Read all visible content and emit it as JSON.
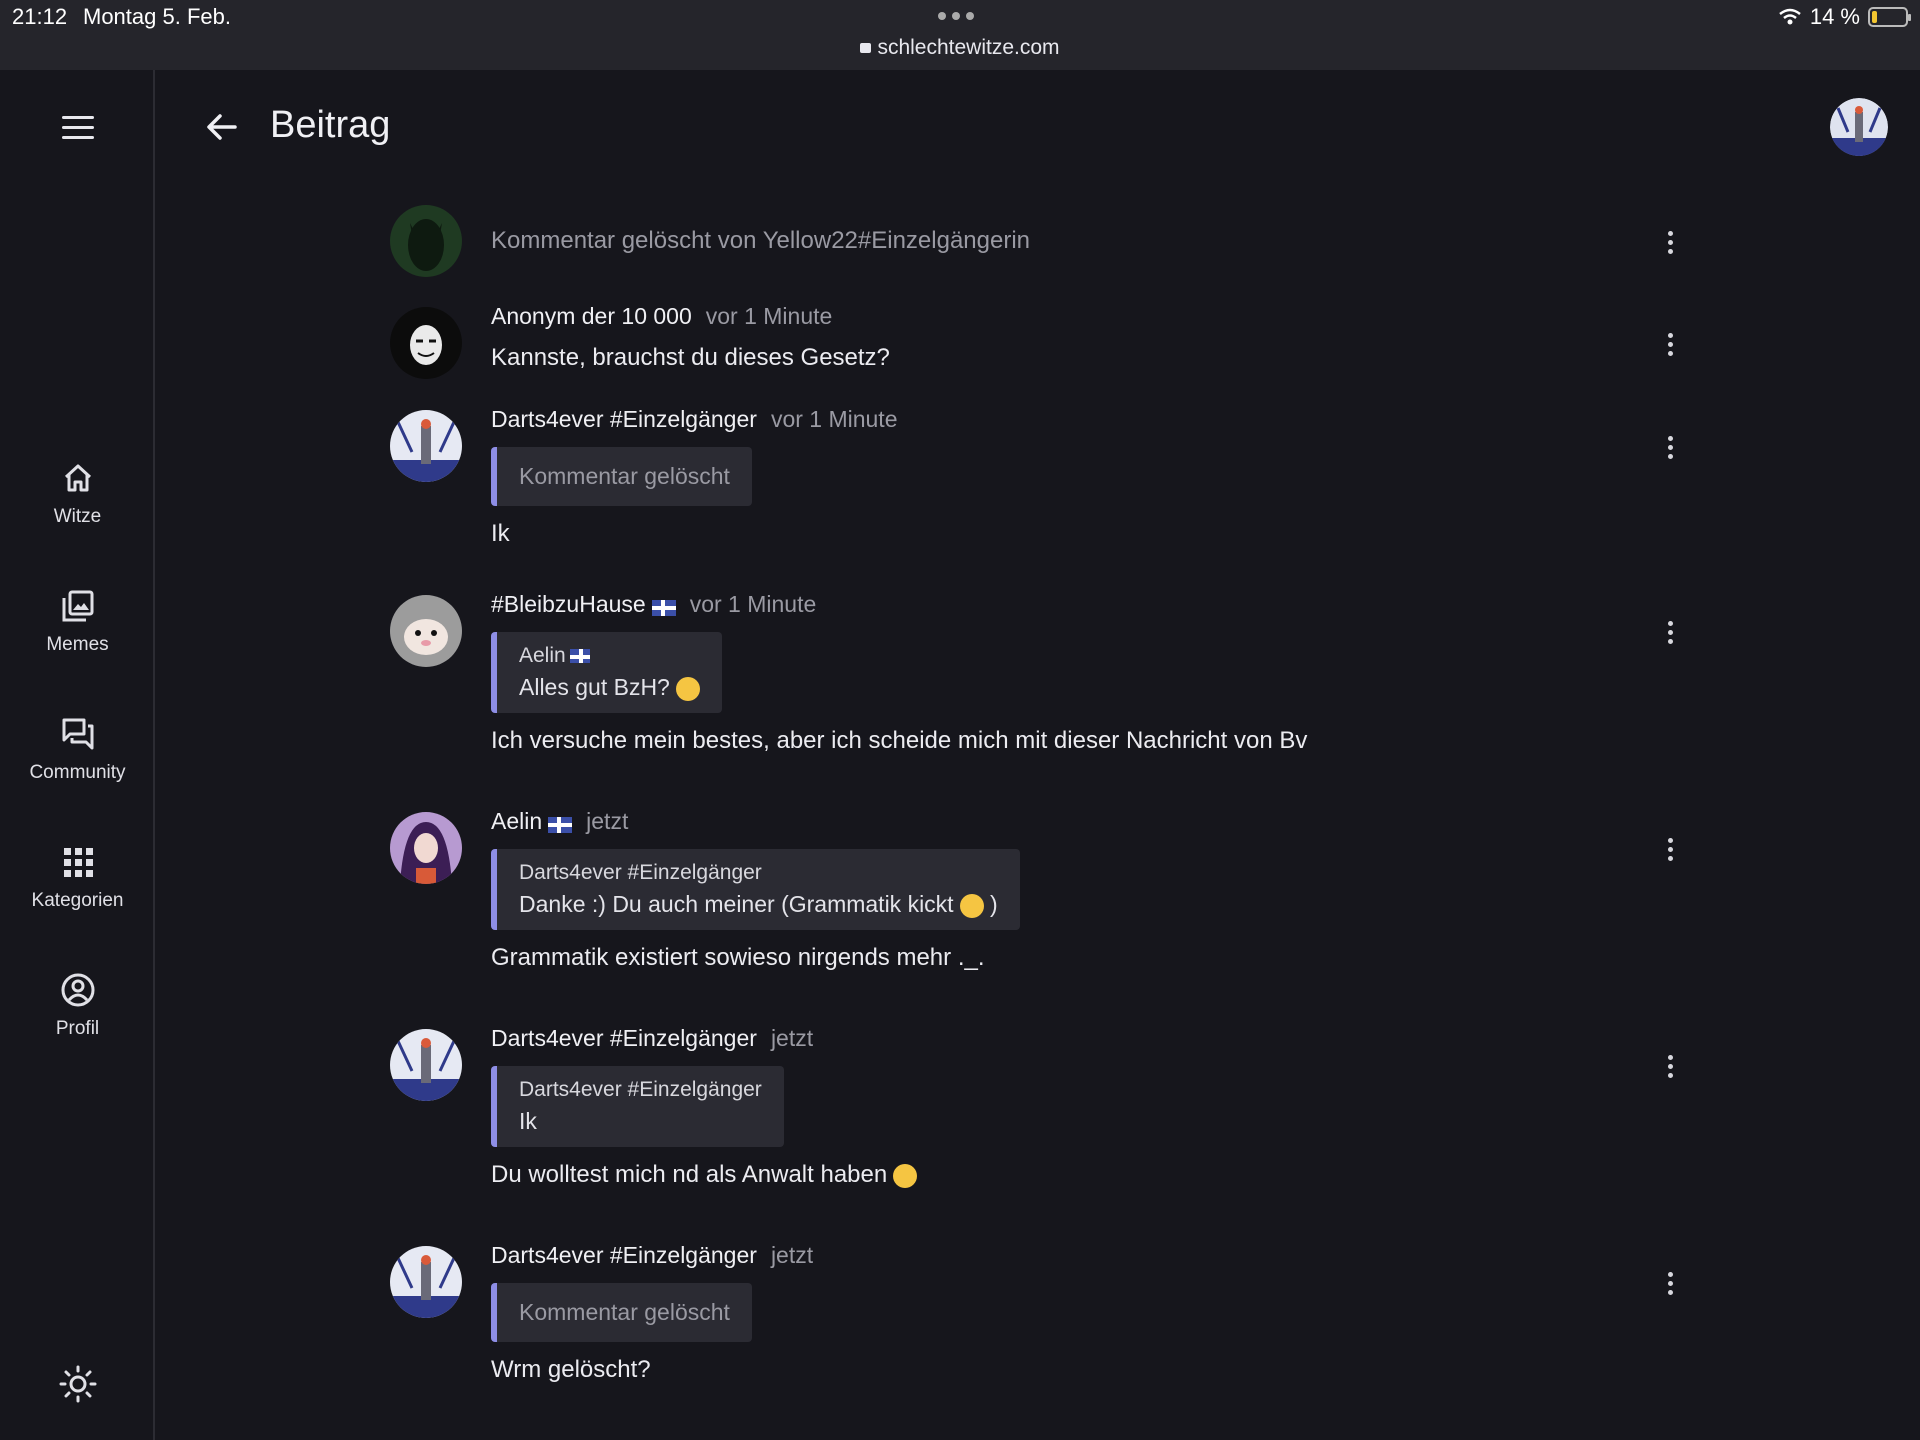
{
  "status_bar": {
    "time": "21:12",
    "date": "Montag 5. Feb.",
    "url": "schlechtewitze.com",
    "battery": "14 %",
    "battery_level": 0.14
  },
  "header": {
    "title": "Beitrag"
  },
  "sidebar": {
    "items": [
      {
        "label": "Witze",
        "icon": "home-icon"
      },
      {
        "label": "Memes",
        "icon": "images-icon"
      },
      {
        "label": "Community",
        "icon": "chat-icon"
      },
      {
        "label": "Kategorien",
        "icon": "grid-icon"
      },
      {
        "label": "Profil",
        "icon": "profile-icon"
      }
    ],
    "theme_icon": "sun-icon"
  },
  "colors": {
    "background": "#16161c",
    "quote_accent": "#8e8ee6",
    "surface": "#2b2b33"
  },
  "comments": [
    {
      "deleted_text": "Kommentar gelöscht von Yellow22#Einzelgängerin"
    },
    {
      "author": "Anonym der 10 000",
      "time": "vor 1 Minute",
      "text": "Kannste, brauchst du dieses Gesetz?"
    },
    {
      "author": "Darts4ever #Einzelgänger",
      "time": "vor 1 Minute",
      "quote_deleted": "Kommentar gelöscht",
      "text": "Ik"
    },
    {
      "author": "#BleibzuHause",
      "time": "vor 1 Minute",
      "quote_author": "Aelin",
      "quote_text": "Alles gut BzH?",
      "text": "Ich versuche mein bestes, aber ich scheide mich mit dieser Nachricht von Bv"
    },
    {
      "author": "Aelin",
      "time": "jetzt",
      "quote_author": "Darts4ever #Einzelgänger",
      "quote_text": "Danke :) Du auch meiner (Grammatik kickt",
      "quote_text_end": ")",
      "text": "Grammatik existiert sowieso nirgends mehr ._."
    },
    {
      "author": "Darts4ever #Einzelgänger",
      "time": "jetzt",
      "quote_author": "Darts4ever #Einzelgänger",
      "quote_text": "Ik",
      "text": "Du wolltest mich nd als Anwalt haben"
    },
    {
      "author": "Darts4ever #Einzelgänger",
      "time": "jetzt",
      "quote_deleted": "Kommentar gelöscht",
      "text": "Wrm gelöscht?"
    }
  ]
}
